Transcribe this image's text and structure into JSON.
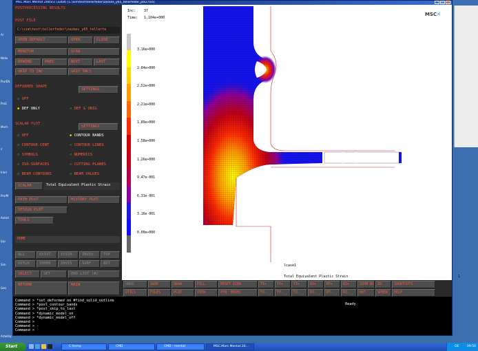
{
  "window": {
    "title": "MSC.Marc Mentat 2005r2 (32bit) [C:\\sim\\test\\tellerfeder\\zackes_y65_tellerfeder_plk2.t16]"
  },
  "desktop": {
    "left_icons": [
      "Ar",
      "Netw",
      "Pro/EN",
      "ProE",
      "Mech",
      "ir",
      "Intel",
      "Pro/M",
      "Autod",
      "ijsp",
      "Sim",
      "Geo",
      "Arbeitsp"
    ]
  },
  "menu": {
    "title": "POSTPROCESSING RESULTS",
    "post_file": {
      "title": "POST FILE",
      "path": "C:\\sim\\test\\tellerfeder\\zackes_y65_tellerte",
      "buttons": {
        "open_default": "OPEN DEFAULT",
        "open": "OPEN",
        "close": "CLOSE",
        "monitor": "MONITOR",
        "scan": "SCAN",
        "rewind": "REWIND",
        "prev": "PREV",
        "next": "NEXT",
        "last": "LAST",
        "skip_to_inc": "SKIP TO INC",
        "skip_incs": "SKIP INCS"
      }
    },
    "deformed_shape": {
      "title": "DEFORMED SHAPE",
      "settings": "SETTINGS",
      "off": "OFF",
      "def_only": "DEF ONLY",
      "def_orig": "DEF & ORIG"
    },
    "scalar_plot": {
      "title": "SCALAR PLOT",
      "settings": "SETTINGS",
      "off": "OFF",
      "contour_bands": "CONTOUR BANDS",
      "contour_cent": "CONTOUR CENT",
      "contour_lines": "CONTOUR LINES",
      "symbols": "SYMBOLS",
      "numerics": "NUMERICS",
      "iso_surfaces": "ISO-SURFACES",
      "cutting_planes": "CUTTING PLANES",
      "beam_contours": "BEAM CONTOURS",
      "beam_values": "BEAM VALUES",
      "scalar": "SCALAR",
      "scalar_value": "Total Equivalent Plastic Strain"
    },
    "path_plot": "PATH PLOT",
    "history_plot": "HISTORY PLOT",
    "design_plot": "DESIGN PLOT",
    "tools": "TOOLS",
    "home_field": "HOME",
    "sel_row1": [
      "ALL",
      "EXIST.",
      "VISIB.",
      "INVIS.",
      "TOP"
    ],
    "sel_row2": [
      "OUTLN",
      "INVER",
      "INVIS",
      "SURF",
      "BOT"
    ],
    "select": "SELECT",
    "set": "SET",
    "end_list": "END LIST (#)",
    "return": "RETURN",
    "main": "MAIN"
  },
  "viewport": {
    "inc_label": "Inc:",
    "inc_value": "37",
    "time_label": "Time:",
    "time_value": "1.104e+000",
    "logo": "MSC",
    "legend_labels": [
      "3.16e+000",
      "2.84e+000",
      "2.52e+000",
      "2.21e+000",
      "1.89e+000",
      "1.58e+000",
      "1.26e+000",
      "9.47e-001",
      "6.31e-001",
      "3.16e-001",
      "0.00e+000"
    ],
    "legend_colors": [
      "#c8c8c8",
      "#ffff00",
      "#ffd400",
      "#ffa000",
      "#ff6a00",
      "#ff2a00",
      "#d40000",
      "#c00018",
      "#b4004c",
      "#8a00a0",
      "#2818d6",
      "#1010ff",
      "#666666"
    ],
    "case_label": "lcase1",
    "footer_label": "Total Equivalent Plastic Strain",
    "footer_number": "1"
  },
  "toolbar": {
    "row1": [
      "UNDO",
      "SAVE",
      "DRAW",
      "FILL",
      "RESET VIEW",
      "TX+",
      "TY+",
      "TZ+",
      "RX+",
      "RY+",
      "RZ+",
      "ZOOM BOX",
      "IN",
      "SHORTCUTS"
    ],
    "row2": [
      "UTILS",
      "FILES",
      "PLOT",
      "VIEW",
      "DYN. MODEL",
      "TX-",
      "TY-",
      "TZ-",
      "RX-",
      "RY-",
      "RZ-",
      "OUT",
      "SPEED",
      "HELP"
    ]
  },
  "console": {
    "lines": [
      "Command > *set_deformed on #find_solid_outline",
      "Command > *post_contour_bands",
      "Command > *post_skip_to_last",
      "Command > *dynamic_model_on",
      "Command > *dynamic_model_off",
      "Command >",
      "Command > -",
      "Command > "
    ],
    "status": "Ready"
  },
  "taskbar": {
    "start": "Start",
    "tasks": [
      "C:\\temp",
      "CMD",
      "CMD - mentat",
      "MSC.Marc Mentat 20..."
    ],
    "tray": "DE",
    "clock": "09:50"
  }
}
